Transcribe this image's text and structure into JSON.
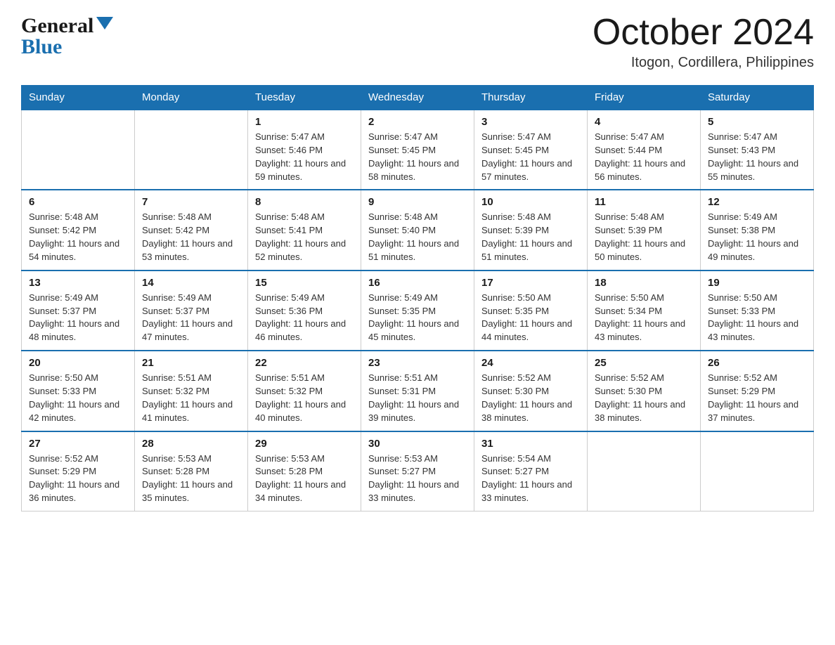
{
  "header": {
    "logo_general": "General",
    "logo_blue": "Blue",
    "month_title": "October 2024",
    "location": "Itogon, Cordillera, Philippines"
  },
  "weekdays": [
    "Sunday",
    "Monday",
    "Tuesday",
    "Wednesday",
    "Thursday",
    "Friday",
    "Saturday"
  ],
  "weeks": [
    [
      {
        "day": "",
        "sunrise": "",
        "sunset": "",
        "daylight": ""
      },
      {
        "day": "",
        "sunrise": "",
        "sunset": "",
        "daylight": ""
      },
      {
        "day": "1",
        "sunrise": "Sunrise: 5:47 AM",
        "sunset": "Sunset: 5:46 PM",
        "daylight": "Daylight: 11 hours and 59 minutes."
      },
      {
        "day": "2",
        "sunrise": "Sunrise: 5:47 AM",
        "sunset": "Sunset: 5:45 PM",
        "daylight": "Daylight: 11 hours and 58 minutes."
      },
      {
        "day": "3",
        "sunrise": "Sunrise: 5:47 AM",
        "sunset": "Sunset: 5:45 PM",
        "daylight": "Daylight: 11 hours and 57 minutes."
      },
      {
        "day": "4",
        "sunrise": "Sunrise: 5:47 AM",
        "sunset": "Sunset: 5:44 PM",
        "daylight": "Daylight: 11 hours and 56 minutes."
      },
      {
        "day": "5",
        "sunrise": "Sunrise: 5:47 AM",
        "sunset": "Sunset: 5:43 PM",
        "daylight": "Daylight: 11 hours and 55 minutes."
      }
    ],
    [
      {
        "day": "6",
        "sunrise": "Sunrise: 5:48 AM",
        "sunset": "Sunset: 5:42 PM",
        "daylight": "Daylight: 11 hours and 54 minutes."
      },
      {
        "day": "7",
        "sunrise": "Sunrise: 5:48 AM",
        "sunset": "Sunset: 5:42 PM",
        "daylight": "Daylight: 11 hours and 53 minutes."
      },
      {
        "day": "8",
        "sunrise": "Sunrise: 5:48 AM",
        "sunset": "Sunset: 5:41 PM",
        "daylight": "Daylight: 11 hours and 52 minutes."
      },
      {
        "day": "9",
        "sunrise": "Sunrise: 5:48 AM",
        "sunset": "Sunset: 5:40 PM",
        "daylight": "Daylight: 11 hours and 51 minutes."
      },
      {
        "day": "10",
        "sunrise": "Sunrise: 5:48 AM",
        "sunset": "Sunset: 5:39 PM",
        "daylight": "Daylight: 11 hours and 51 minutes."
      },
      {
        "day": "11",
        "sunrise": "Sunrise: 5:48 AM",
        "sunset": "Sunset: 5:39 PM",
        "daylight": "Daylight: 11 hours and 50 minutes."
      },
      {
        "day": "12",
        "sunrise": "Sunrise: 5:49 AM",
        "sunset": "Sunset: 5:38 PM",
        "daylight": "Daylight: 11 hours and 49 minutes."
      }
    ],
    [
      {
        "day": "13",
        "sunrise": "Sunrise: 5:49 AM",
        "sunset": "Sunset: 5:37 PM",
        "daylight": "Daylight: 11 hours and 48 minutes."
      },
      {
        "day": "14",
        "sunrise": "Sunrise: 5:49 AM",
        "sunset": "Sunset: 5:37 PM",
        "daylight": "Daylight: 11 hours and 47 minutes."
      },
      {
        "day": "15",
        "sunrise": "Sunrise: 5:49 AM",
        "sunset": "Sunset: 5:36 PM",
        "daylight": "Daylight: 11 hours and 46 minutes."
      },
      {
        "day": "16",
        "sunrise": "Sunrise: 5:49 AM",
        "sunset": "Sunset: 5:35 PM",
        "daylight": "Daylight: 11 hours and 45 minutes."
      },
      {
        "day": "17",
        "sunrise": "Sunrise: 5:50 AM",
        "sunset": "Sunset: 5:35 PM",
        "daylight": "Daylight: 11 hours and 44 minutes."
      },
      {
        "day": "18",
        "sunrise": "Sunrise: 5:50 AM",
        "sunset": "Sunset: 5:34 PM",
        "daylight": "Daylight: 11 hours and 43 minutes."
      },
      {
        "day": "19",
        "sunrise": "Sunrise: 5:50 AM",
        "sunset": "Sunset: 5:33 PM",
        "daylight": "Daylight: 11 hours and 43 minutes."
      }
    ],
    [
      {
        "day": "20",
        "sunrise": "Sunrise: 5:50 AM",
        "sunset": "Sunset: 5:33 PM",
        "daylight": "Daylight: 11 hours and 42 minutes."
      },
      {
        "day": "21",
        "sunrise": "Sunrise: 5:51 AM",
        "sunset": "Sunset: 5:32 PM",
        "daylight": "Daylight: 11 hours and 41 minutes."
      },
      {
        "day": "22",
        "sunrise": "Sunrise: 5:51 AM",
        "sunset": "Sunset: 5:32 PM",
        "daylight": "Daylight: 11 hours and 40 minutes."
      },
      {
        "day": "23",
        "sunrise": "Sunrise: 5:51 AM",
        "sunset": "Sunset: 5:31 PM",
        "daylight": "Daylight: 11 hours and 39 minutes."
      },
      {
        "day": "24",
        "sunrise": "Sunrise: 5:52 AM",
        "sunset": "Sunset: 5:30 PM",
        "daylight": "Daylight: 11 hours and 38 minutes."
      },
      {
        "day": "25",
        "sunrise": "Sunrise: 5:52 AM",
        "sunset": "Sunset: 5:30 PM",
        "daylight": "Daylight: 11 hours and 38 minutes."
      },
      {
        "day": "26",
        "sunrise": "Sunrise: 5:52 AM",
        "sunset": "Sunset: 5:29 PM",
        "daylight": "Daylight: 11 hours and 37 minutes."
      }
    ],
    [
      {
        "day": "27",
        "sunrise": "Sunrise: 5:52 AM",
        "sunset": "Sunset: 5:29 PM",
        "daylight": "Daylight: 11 hours and 36 minutes."
      },
      {
        "day": "28",
        "sunrise": "Sunrise: 5:53 AM",
        "sunset": "Sunset: 5:28 PM",
        "daylight": "Daylight: 11 hours and 35 minutes."
      },
      {
        "day": "29",
        "sunrise": "Sunrise: 5:53 AM",
        "sunset": "Sunset: 5:28 PM",
        "daylight": "Daylight: 11 hours and 34 minutes."
      },
      {
        "day": "30",
        "sunrise": "Sunrise: 5:53 AM",
        "sunset": "Sunset: 5:27 PM",
        "daylight": "Daylight: 11 hours and 33 minutes."
      },
      {
        "day": "31",
        "sunrise": "Sunrise: 5:54 AM",
        "sunset": "Sunset: 5:27 PM",
        "daylight": "Daylight: 11 hours and 33 minutes."
      },
      {
        "day": "",
        "sunrise": "",
        "sunset": "",
        "daylight": ""
      },
      {
        "day": "",
        "sunrise": "",
        "sunset": "",
        "daylight": ""
      }
    ]
  ]
}
